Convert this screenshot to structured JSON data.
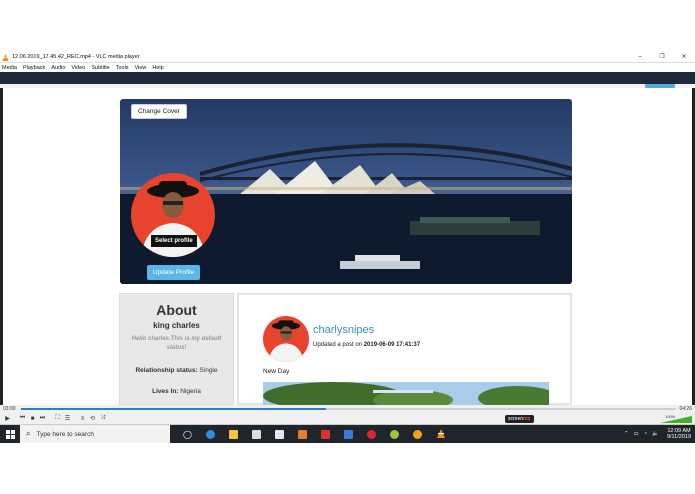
{
  "window": {
    "title": "12.06.2019_17.45.42_REC.mp4 - VLC media player",
    "controls": [
      "–",
      "❐",
      "✕"
    ]
  },
  "menu": [
    "Media",
    "Playback",
    "Audio",
    "Video",
    "Subtitle",
    "Tools",
    "View",
    "Help"
  ],
  "profile": {
    "change_cover": "Change Cover",
    "select_profile": "Select profile",
    "update_profile": "Update Profile"
  },
  "about": {
    "heading": "About",
    "name": "king charles",
    "status": "Hello charles.This is my default status!",
    "relationship_label": "Relationship status:",
    "relationship_value": "Single",
    "lives_label": "Lives In:",
    "lives_value": "Nigeria"
  },
  "post": {
    "username": "charlysnipes",
    "meta_prefix": "Updated a post on",
    "meta_date": "2019-06-09 17:41:37",
    "content": "New Day"
  },
  "player": {
    "time_elapsed": "03:00",
    "time_total": "04:26",
    "progress": 0.465,
    "volume_pct": "100%",
    "brand_prefix": "screen",
    "brand_suffix": "rec"
  },
  "taskbar": {
    "search_placeholder": "Type here to search",
    "time": "12:09 AM",
    "date": "9/11/2019"
  },
  "colors": {
    "accent": "#3c8dbc",
    "button": "#5ab6e8",
    "avatar_bg": "#e8432d",
    "taskbar": "#20242b"
  }
}
